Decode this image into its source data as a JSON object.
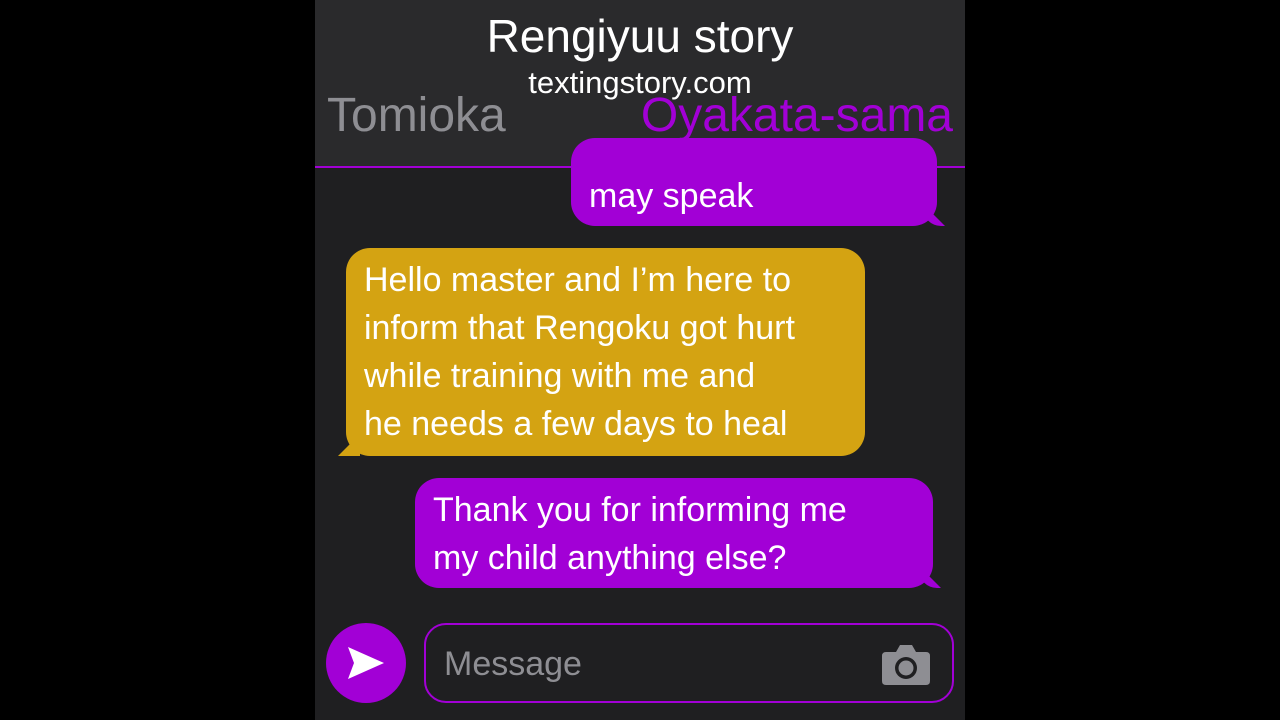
{
  "header": {
    "title": "Rengiyuu story",
    "site": "textingstory.com",
    "contact_left": "Tomioka",
    "contact_right": "Oyakata-sama"
  },
  "messages": [
    {
      "sender": "Oyakata-sama",
      "side": "right",
      "text": "may speak"
    },
    {
      "sender": "Tomioka",
      "side": "left",
      "text": "Hello master and I’m here to\ninform that Rengoku got hurt\nwhile training with me and\nhe needs a few days to heal"
    },
    {
      "sender": "Oyakata-sama",
      "side": "right",
      "text": "Thank you for informing me\nmy child anything else?"
    }
  ],
  "composer": {
    "placeholder": "Message",
    "send_icon": "send-arrow-icon",
    "camera_icon": "camera-icon"
  },
  "colors": {
    "sent_bubble": "#a200d6",
    "received_bubble": "#d4a312",
    "background": "#1f1f21",
    "header_bg": "#2a2a2c",
    "inactive_name": "#8e8e93"
  }
}
